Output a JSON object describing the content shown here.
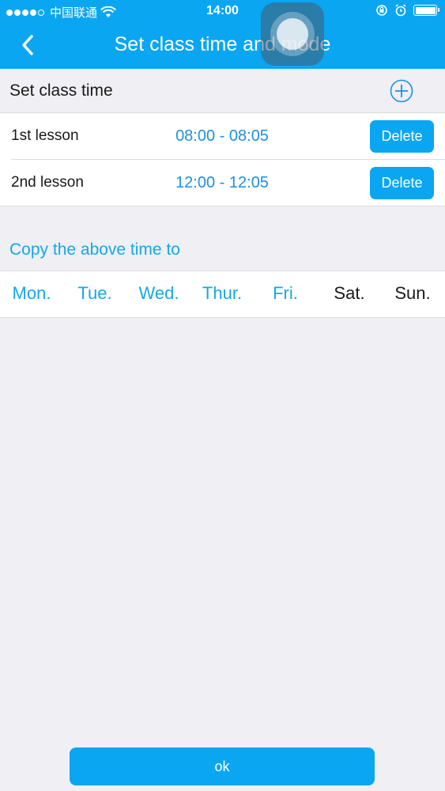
{
  "status_bar": {
    "carrier": "中国联通",
    "time": "14:00"
  },
  "nav": {
    "title": "Set class time and mode"
  },
  "class_time": {
    "title": "Set class time",
    "lessons": [
      {
        "name": "1st lesson",
        "time": "08:00 - 08:05",
        "delete_label": "Delete"
      },
      {
        "name": "2nd lesson",
        "time": "12:00 - 12:05",
        "delete_label": "Delete"
      }
    ]
  },
  "copy": {
    "title": "Copy the above time to",
    "days": [
      {
        "label": "Mon.",
        "selected": true
      },
      {
        "label": "Tue.",
        "selected": true
      },
      {
        "label": "Wed.",
        "selected": true
      },
      {
        "label": "Thur.",
        "selected": true
      },
      {
        "label": "Fri.",
        "selected": true
      },
      {
        "label": "Sat.",
        "selected": false
      },
      {
        "label": "Sun.",
        "selected": false
      }
    ]
  },
  "footer": {
    "ok_label": "ok"
  },
  "colors": {
    "accent": "#0aa6f2",
    "link": "#14a8e8",
    "background": "#efeff4"
  }
}
